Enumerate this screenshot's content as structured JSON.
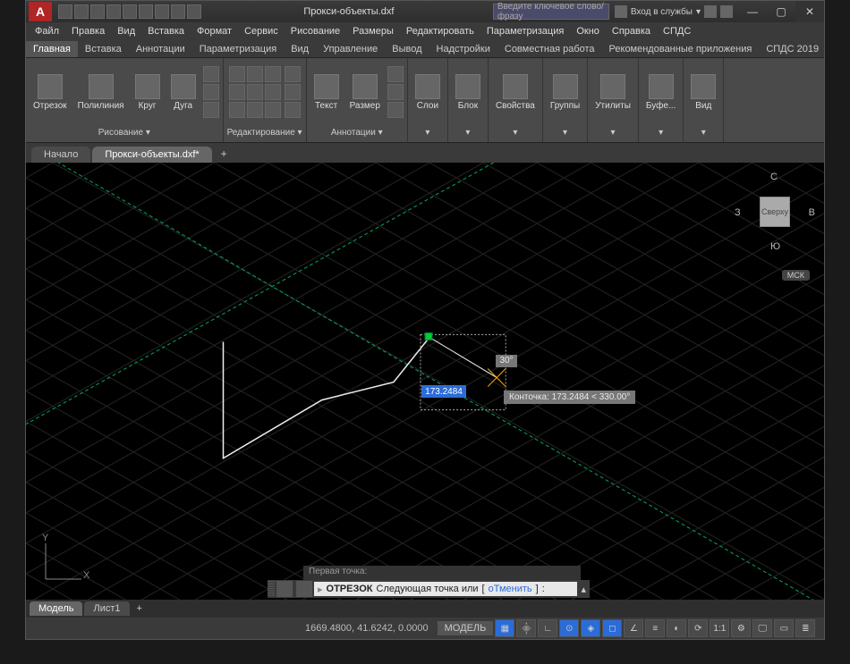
{
  "title": "Прокси-объекты.dxf",
  "search_placeholder": "Введите ключевое слово/фразу",
  "login_text": "Вход в службы",
  "app_logo_letter": "A",
  "menubar": [
    "Файл",
    "Правка",
    "Вид",
    "Вставка",
    "Формат",
    "Сервис",
    "Рисование",
    "Размеры",
    "Редактировать",
    "Параметризация",
    "Окно",
    "Справка",
    "СПДС"
  ],
  "ribbon_tabs": [
    "Главная",
    "Вставка",
    "Аннотации",
    "Параметризация",
    "Вид",
    "Управление",
    "Вывод",
    "Надстройки",
    "Совместная работа",
    "Рекомендованные приложения",
    "СПДС 2019"
  ],
  "ribbon": {
    "draw": {
      "title": "Рисование ▾",
      "line": "Отрезок",
      "polyline": "Полилиния",
      "circle": "Круг",
      "arc": "Дуга"
    },
    "edit": {
      "title": "Редактирование ▾"
    },
    "annot": {
      "title": "Аннотации ▾",
      "text": "Текст",
      "dim": "Размер"
    },
    "layers": {
      "title": "Слои"
    },
    "block": {
      "title": "Блок"
    },
    "props": {
      "title": "Свойства"
    },
    "groups": {
      "title": "Группы"
    },
    "utils": {
      "title": "Утилиты"
    },
    "clip": {
      "title": "Буфе..."
    },
    "view": {
      "title": "Вид"
    }
  },
  "doc_tabs": {
    "start": "Начало",
    "file": "Прокси-объекты.dxf*"
  },
  "dynamic": {
    "length_value": "173.2484",
    "angle_value": "30°",
    "tooltip": "Конточка: 173.2484 < 330.00°"
  },
  "viewcube": {
    "top": "Сверху",
    "n": "С",
    "s": "Ю",
    "e": "В",
    "w": "З"
  },
  "wcs": "МСК",
  "ucs": {
    "x": "X",
    "y": "Y"
  },
  "cmd_history_line": "Первая точка:",
  "cmd": {
    "name": "ОТРЕЗОК",
    "prompt": "Следующая точка или",
    "opt": "оТменить",
    "after": ":"
  },
  "bottom_tabs": {
    "model": "Модель",
    "sheet1": "Лист1"
  },
  "status": {
    "coords": "1669.4800, 41.6242, 0.0000",
    "model": "МОДЕЛЬ",
    "scale": "1:1"
  }
}
